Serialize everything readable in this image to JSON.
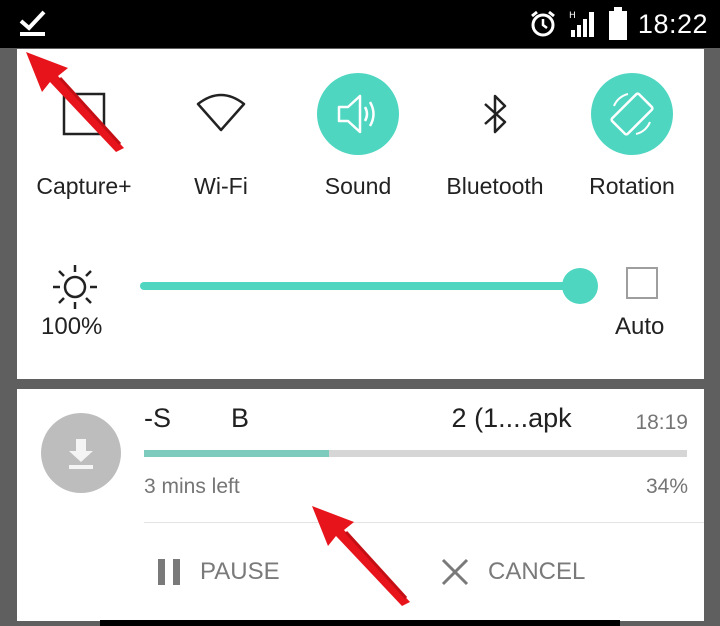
{
  "status_bar": {
    "time": "18:22",
    "network": "H"
  },
  "quick_settings": {
    "toggles": [
      {
        "label": "Capture+",
        "icon": "capture-icon",
        "active": false
      },
      {
        "label": "Wi-Fi",
        "icon": "wifi-icon",
        "active": false
      },
      {
        "label": "Sound",
        "icon": "sound-icon",
        "active": true
      },
      {
        "label": "Bluetooth",
        "icon": "bluetooth-icon",
        "active": false
      },
      {
        "label": "Rotation",
        "icon": "rotation-icon",
        "active": true
      }
    ],
    "brightness": {
      "value_label": "100%",
      "level": 1.0,
      "auto_label": "Auto",
      "auto_checked": false
    }
  },
  "notification": {
    "title": "-S        B                           2 (1....apk",
    "time": "18:19",
    "time_left": "3 mins left",
    "percent_label": "34%",
    "progress": 0.34,
    "pause_label": "PAUSE",
    "cancel_label": "CANCEL"
  },
  "colors": {
    "accent": "#4ed6c1",
    "progress_fill": "#7ccbbd",
    "annotation_arrow": "#e8141c"
  }
}
